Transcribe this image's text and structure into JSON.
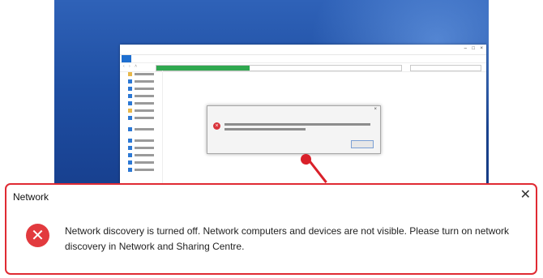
{
  "colors": {
    "accent_red": "#e02a33",
    "error_red": "#e23a3e",
    "desktop_blue": "#1f4fa3",
    "file_tab_blue": "#1e6fd0",
    "progress_green": "#2fa84f"
  },
  "screenshot": {
    "explorer": {
      "address_progress": 0.38,
      "nav_items": [
        "yellow",
        "blue",
        "blue",
        "blue",
        "blue",
        "yellow",
        "blue",
        "gap",
        "blue",
        "gap",
        "blue",
        "blue",
        "blue",
        "blue",
        "blue"
      ]
    },
    "mini_dialog": {
      "error_icon": "error-icon"
    }
  },
  "dialog": {
    "title": "Network",
    "close_glyph": "✕",
    "error_icon": "error-icon",
    "error_glyph": "✕",
    "message": "Network discovery is turned off. Network computers and devices are not visible. Please turn on network discovery in Network and Sharing Centre."
  }
}
